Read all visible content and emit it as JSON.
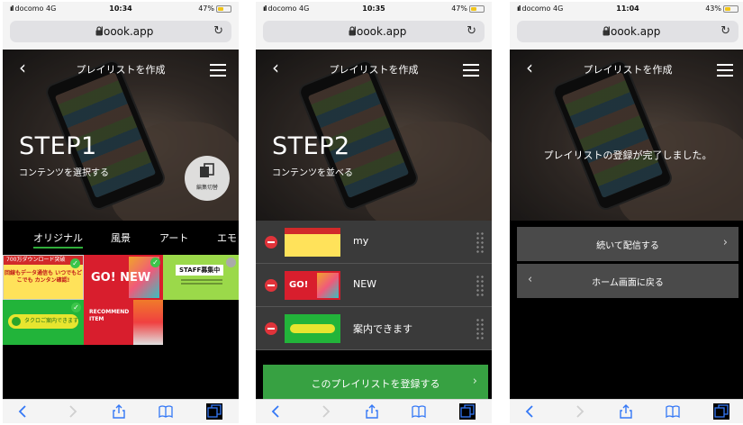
{
  "colors": {
    "accent_green": "#37a142",
    "delete_red": "#e0333a",
    "link_blue": "#3478f6"
  },
  "screens": [
    {
      "status": {
        "carrier": "docomo",
        "network": "4G",
        "time": "10:34",
        "battery": "47%",
        "battery_level": 0.47
      },
      "url": "loook.app",
      "nav_title": "プレイリストを作成",
      "step_title": "STEP1",
      "step_sub": "コンテンツを選択する",
      "edit_label": "編集切替",
      "tabs": [
        "オリジナル",
        "風景",
        "アート",
        "エモ"
      ],
      "active_tab": "オリジナル",
      "tiles": [
        {
          "header": "700万ダウンロード突破",
          "text": "回線もデータ通信も いつでもどこでも カンタン確認!",
          "selected": true
        },
        {
          "text": "GO! NEW",
          "selected": true
        },
        {
          "text": "STAFF募集中",
          "selected": false
        },
        {
          "text": "タクロご案内できます",
          "selected": true
        },
        {
          "text": "RECOMMEND ITEM",
          "selected": false
        }
      ]
    },
    {
      "status": {
        "carrier": "docomo",
        "network": "4G",
        "time": "10:35",
        "battery": "47%",
        "battery_level": 0.47
      },
      "url": "loook.app",
      "nav_title": "プレイリストを作成",
      "step_title": "STEP2",
      "step_sub": "コンテンツを並べる",
      "items": [
        {
          "name": "my"
        },
        {
          "name": "NEW"
        },
        {
          "name": "案内できます"
        }
      ],
      "register_label": "このプレイリストを登録する"
    },
    {
      "status": {
        "carrier": "docomo",
        "network": "4G",
        "time": "11:04",
        "battery": "43%",
        "battery_level": 0.43
      },
      "url": "loook.app",
      "nav_title": "プレイリストを作成",
      "done_message": "プレイリストの登録が完了しました。",
      "continue_label": "続いて配信する",
      "home_label": "ホーム画面に戻る"
    }
  ],
  "icons": [
    "back-icon",
    "menu-icon",
    "lock-icon",
    "reload-icon",
    "edit-toggle-icon",
    "check-icon",
    "minus-icon",
    "drag-handle-icon",
    "chevron-right-icon",
    "chevron-left-icon",
    "share-icon",
    "bookmarks-icon",
    "tabs-icon"
  ]
}
